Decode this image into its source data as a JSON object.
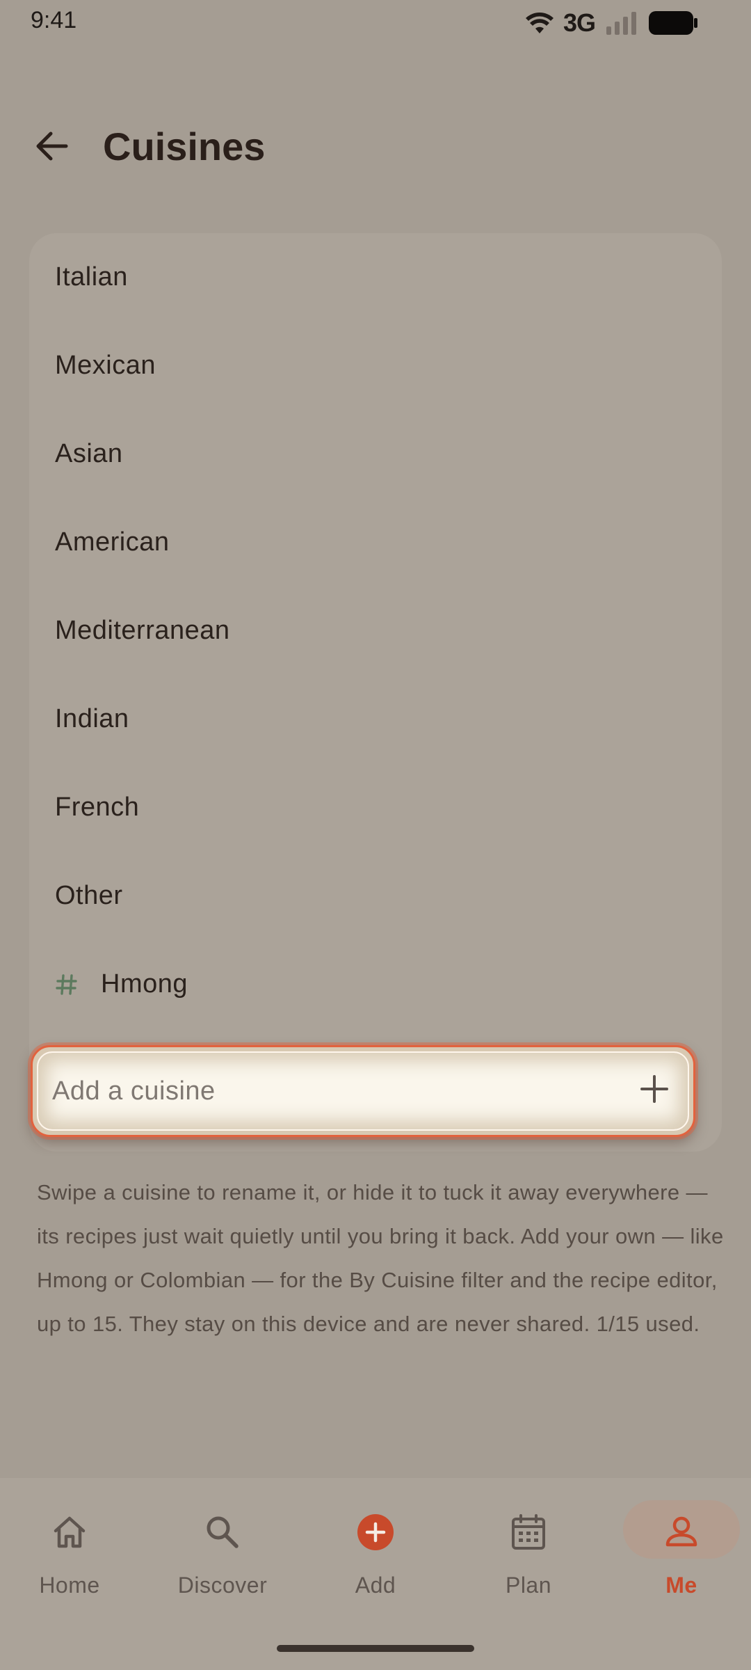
{
  "status_bar": {
    "time": "9:41",
    "network": "3G",
    "icons": [
      "wifi-icon",
      "signal-icon",
      "battery-icon"
    ]
  },
  "header": {
    "title": "Cuisines",
    "back_icon": "arrow-left-icon"
  },
  "cuisines": [
    {
      "label": "Italian",
      "custom": false
    },
    {
      "label": "Mexican",
      "custom": false
    },
    {
      "label": "Asian",
      "custom": false
    },
    {
      "label": "American",
      "custom": false
    },
    {
      "label": "Mediterranean",
      "custom": false
    },
    {
      "label": "Indian",
      "custom": false
    },
    {
      "label": "French",
      "custom": false
    },
    {
      "label": "Other",
      "custom": false
    },
    {
      "label": "Hmong",
      "custom": true,
      "icon": "hash-icon"
    }
  ],
  "add_field": {
    "placeholder": "Add a cuisine",
    "value": "",
    "icon": "plus-icon"
  },
  "help_text": "Swipe a cuisine to rename it, or hide it to tuck it away everywhere — its recipes just wait quietly until you bring it back. Add your own — like Hmong or Colombian — for the By Cuisine filter and the recipe editor, up to 15. They stay on this device and are never shared. 1/15 used.",
  "bottom_nav": {
    "items": [
      {
        "label": "Home",
        "icon": "home-icon",
        "active": false
      },
      {
        "label": "Discover",
        "icon": "search-icon",
        "active": false
      },
      {
        "label": "Add",
        "icon": "add-circle-icon",
        "active": false
      },
      {
        "label": "Plan",
        "icon": "calendar-icon",
        "active": false
      },
      {
        "label": "Me",
        "icon": "person-icon",
        "active": true
      }
    ]
  },
  "colors": {
    "background": "#a59d93",
    "card": "#aba399",
    "accent": "#e2623e",
    "active_nav": "#c84a2b",
    "hash_icon": "#5c7a5e"
  }
}
